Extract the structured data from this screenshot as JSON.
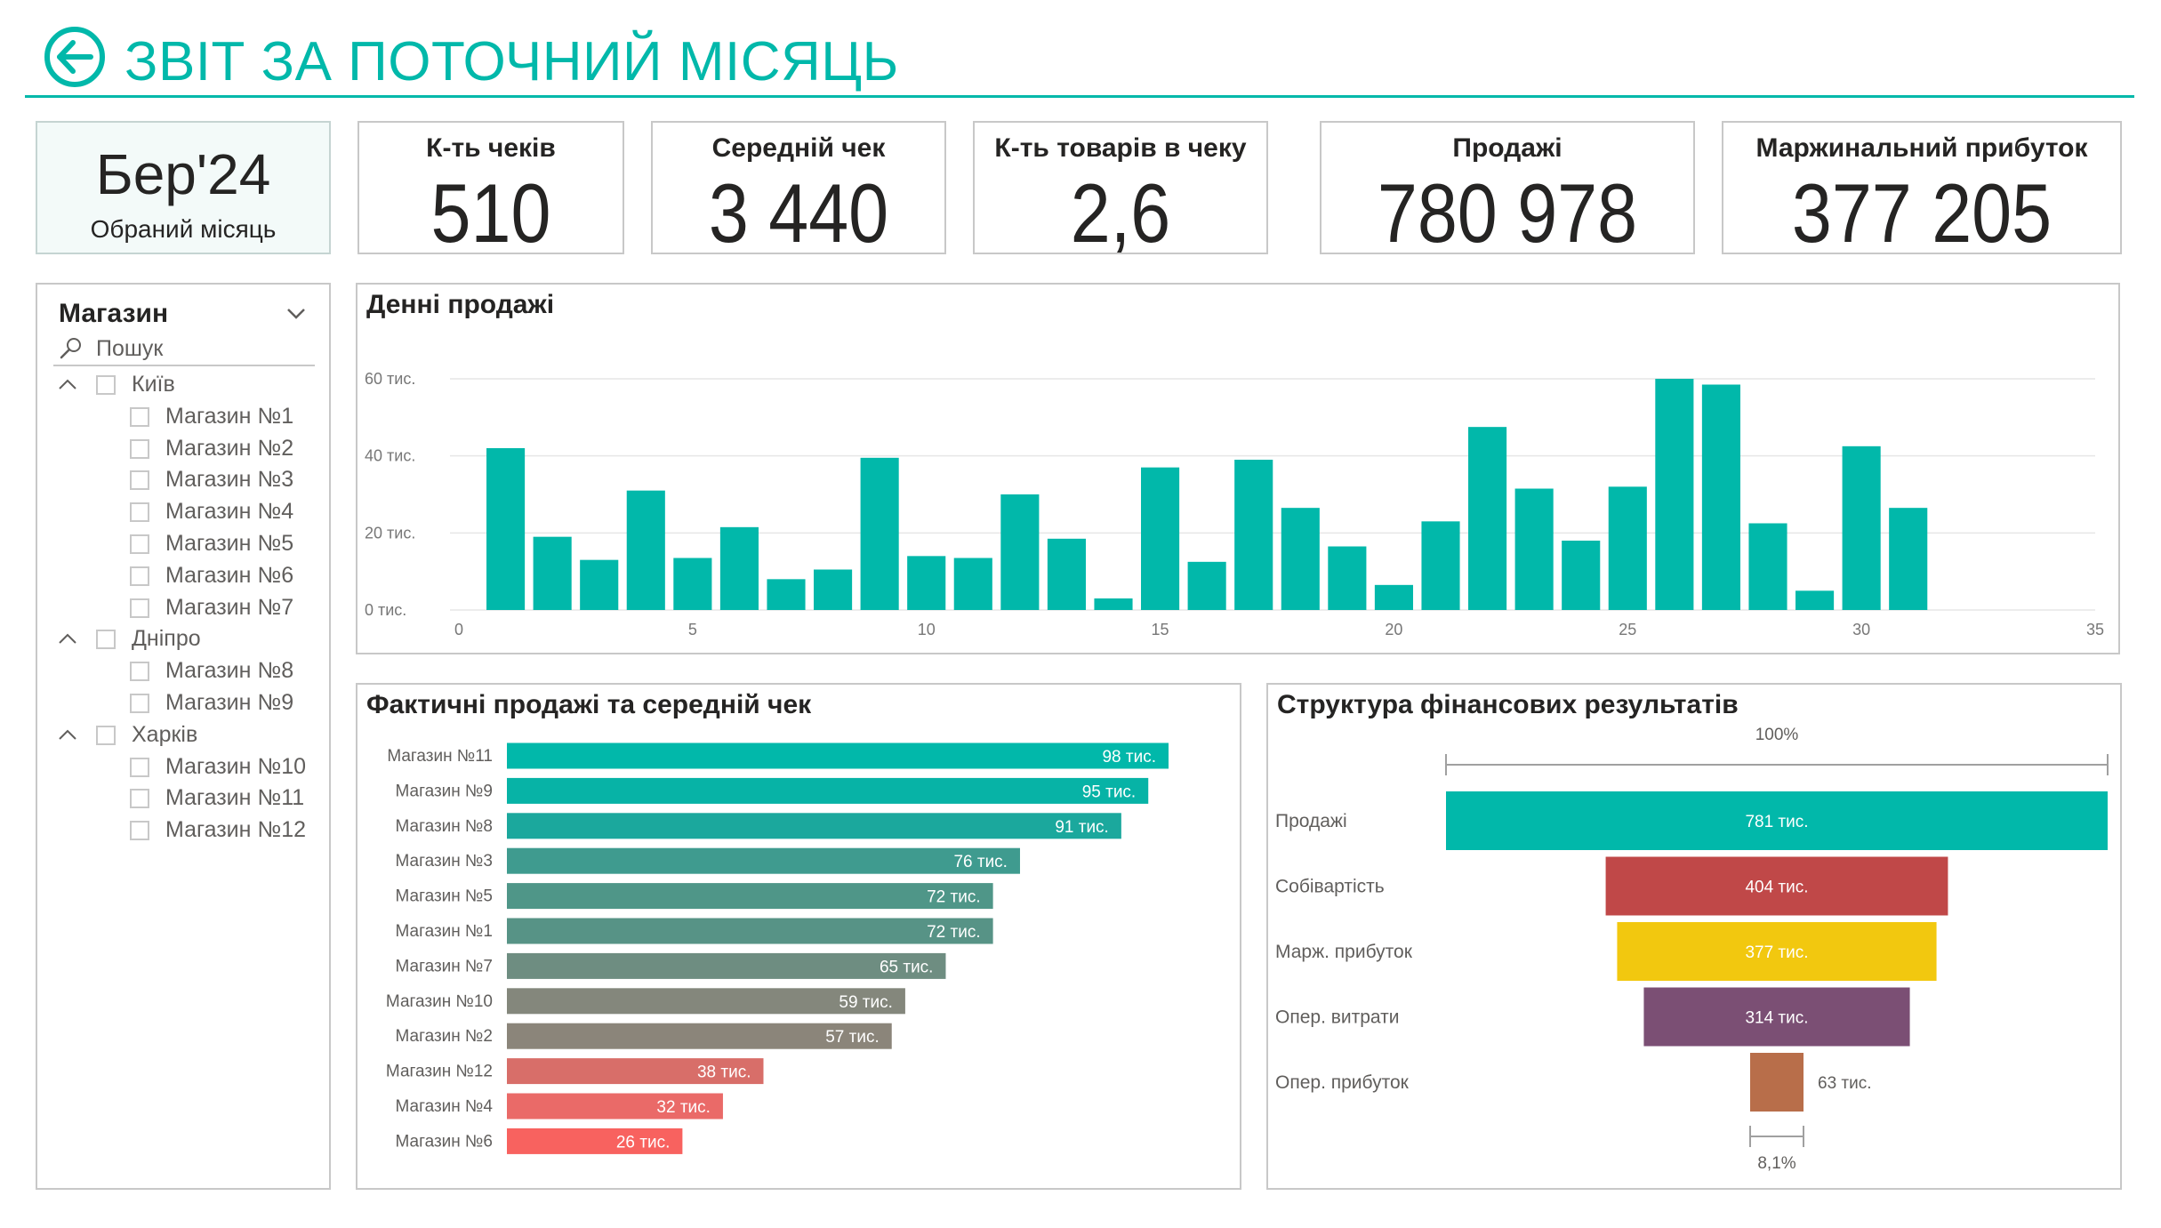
{
  "header": {
    "title": "ЗВІТ ЗА ПОТОЧНИЙ МІСЯЦЬ"
  },
  "month": {
    "value": "Бер'24",
    "label": "Обраний місяць"
  },
  "kpis": [
    {
      "title": "К-ть чеків",
      "value": "510"
    },
    {
      "title": "Середній чек",
      "value": "3 440"
    },
    {
      "title": "К-ть товарів в чеку",
      "value": "2,6"
    },
    {
      "title": "Продажі",
      "value": "780 978"
    },
    {
      "title": "Маржинальний прибуток",
      "value": "377 205"
    }
  ],
  "slicer": {
    "title": "Магазин",
    "search_placeholder": "Пошук",
    "groups": [
      {
        "label": "Київ",
        "items": [
          "Магазин №1",
          "Магазин №2",
          "Магазин №3",
          "Магазин №4",
          "Магазин №5",
          "Магазин №6",
          "Магазин №7"
        ]
      },
      {
        "label": "Дніпро",
        "items": [
          "Магазин №8",
          "Магазин №9"
        ]
      },
      {
        "label": "Харків",
        "items": [
          "Магазин №10",
          "Магазин №11",
          "Магазин №12"
        ]
      }
    ]
  },
  "colors": {
    "accent": "#01b8aa",
    "cost": "#c04848",
    "margin": "#f2c80f",
    "opex": "#7b4f74",
    "op_profit": "#b86e4a"
  },
  "chart_data": [
    {
      "type": "bar",
      "title": "Денні продажі",
      "x": [
        1,
        2,
        3,
        4,
        5,
        6,
        7,
        8,
        9,
        10,
        11,
        12,
        13,
        14,
        15,
        16,
        17,
        18,
        19,
        20,
        21,
        22,
        23,
        24,
        25,
        26,
        27,
        28,
        29,
        30,
        31
      ],
      "values": [
        42000,
        19000,
        13000,
        31000,
        13500,
        21500,
        8000,
        10500,
        39500,
        14000,
        13500,
        30000,
        18500,
        3000,
        37000,
        12500,
        39000,
        26500,
        16500,
        6500,
        23000,
        47500,
        31500,
        18000,
        32000,
        60000,
        58500,
        22500,
        5000,
        42500,
        26500
      ],
      "xlim": [
        0,
        35
      ],
      "xticks": [
        "0",
        "5",
        "10",
        "15",
        "20",
        "25",
        "30",
        "35"
      ],
      "ylim": [
        0,
        60000
      ],
      "yticks": [
        "0 тис.",
        "20 тис.",
        "40 тис.",
        "60 тис."
      ],
      "grid": true,
      "color": "#01b8aa"
    },
    {
      "type": "bar",
      "orientation": "horizontal",
      "title": "Фактичні продажі та середній чек",
      "categories": [
        "Магазин №11",
        "Магазин №9",
        "Магазин №8",
        "Магазин №3",
        "Магазин №5",
        "Магазин №1",
        "Магазин №7",
        "Магазин №10",
        "Магазин №2",
        "Магазин №12",
        "Магазин №4",
        "Магазин №6"
      ],
      "values": [
        98,
        95,
        91,
        76,
        72,
        72,
        65,
        59,
        57,
        38,
        32,
        26
      ],
      "labels": [
        "98 тис.",
        "95 тис.",
        "91 тис.",
        "76 тис.",
        "72 тис.",
        "72 тис.",
        "65 тис.",
        "59 тис.",
        "57 тис.",
        "38 тис.",
        "32 тис.",
        "26 тис."
      ],
      "colors": [
        "#01b8aa",
        "#07b3a6",
        "#1ba89d",
        "#3f9b8f",
        "#4f9688",
        "#579386",
        "#6e8d81",
        "#84877c",
        "#8b857a",
        "#d86e69",
        "#ea6a68",
        "#f8625f"
      ],
      "units": "тис."
    },
    {
      "type": "funnel",
      "title": "Структура фінансових результатів",
      "categories": [
        "Продажі",
        "Собівартість",
        "Марж. прибуток",
        "Опер. витрати",
        "Опер. прибуток"
      ],
      "values": [
        781,
        404,
        377,
        314,
        63
      ],
      "labels": [
        "781 тис.",
        "404 тис.",
        "377 тис.",
        "314 тис.",
        "63 тис."
      ],
      "colors": [
        "#01b8aa",
        "#c04848",
        "#f2c80f",
        "#7b4f74",
        "#b86e4a"
      ],
      "top_label": "100%",
      "bottom_label": "8,1%"
    }
  ]
}
